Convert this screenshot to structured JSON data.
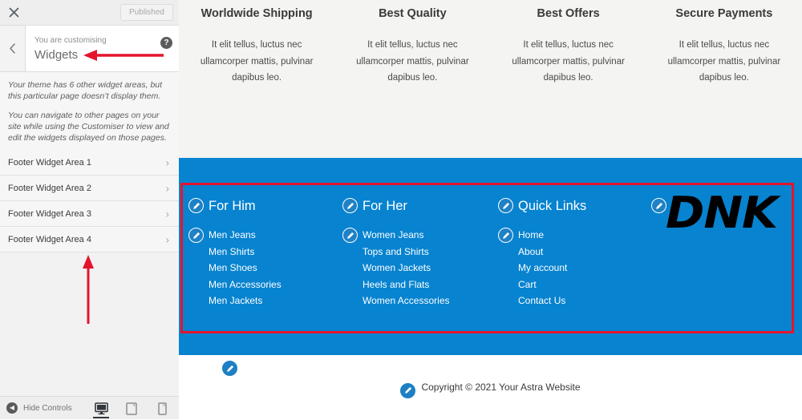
{
  "customizer": {
    "close_icon": "close-icon",
    "publish_label": "Published",
    "back_icon": "chevron-left-icon",
    "eyebrow": "You are customising",
    "title": "Widgets",
    "help_icon": "help-icon",
    "help_glyph": "?",
    "notice": [
      "Your theme has 6 other widget areas, but this particular page doesn’t display them.",
      "You can navigate to other pages on your site while using the Customiser to view and edit the widgets displayed on those pages."
    ],
    "items": [
      {
        "label": "Footer Widget Area 1",
        "chevron": "›"
      },
      {
        "label": "Footer Widget Area 2",
        "chevron": "›"
      },
      {
        "label": "Footer Widget Area 3",
        "chevron": "›"
      },
      {
        "label": "Footer Widget Area 4",
        "chevron": "›"
      }
    ],
    "hide_controls_label": "Hide Controls",
    "hide_controls_glyph": "◀",
    "devices": [
      {
        "name": "desktop",
        "active": true
      },
      {
        "name": "tablet",
        "active": false
      },
      {
        "name": "mobile",
        "active": false
      }
    ]
  },
  "preview": {
    "features": [
      {
        "title": "Worldwide Shipping",
        "body": "It elit tellus, luctus nec ullamcorper mattis, pulvinar dapibus leo."
      },
      {
        "title": "Best Quality",
        "body": "It elit tellus, luctus nec ullamcorper mattis, pulvinar dapibus leo."
      },
      {
        "title": "Best Offers",
        "body": "It elit tellus, luctus nec ullamcorper mattis, pulvinar dapibus leo."
      },
      {
        "title": "Secure Payments",
        "body": "It elit tellus, luctus nec ullamcorper mattis, pulvinar dapibus leo."
      }
    ],
    "footer_widgets": {
      "background_color": "#0783d0",
      "columns": [
        {
          "heading": "For Him",
          "links": [
            "Men Jeans",
            "Men Shirts",
            "Men Shoes",
            "Men Accessories",
            "Men Jackets"
          ]
        },
        {
          "heading": "For Her",
          "links": [
            "Women Jeans",
            "Tops and Shirts",
            "Women Jackets",
            "Heels and Flats",
            "Women Accessories"
          ]
        },
        {
          "heading": "Quick Links",
          "links": [
            "Home",
            "About",
            "My account",
            "Cart",
            "Contact Us"
          ]
        },
        {
          "logo_text": "DNK"
        }
      ]
    },
    "footer_bottom": {
      "copyright": "Copyright © 2021 Your Astra Website"
    }
  },
  "annotations": {
    "box_color": "#e5142d",
    "arrow_color": "#e5142d",
    "box_target": "footer-widget-areas",
    "arrow_left_target": "widgets-panel-title",
    "arrow_up_target": "footer-widget-area-4"
  }
}
